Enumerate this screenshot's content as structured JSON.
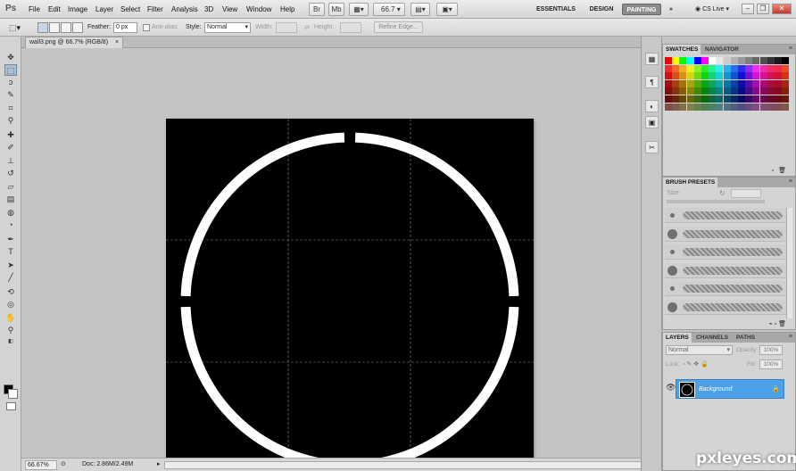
{
  "app": {
    "logo": "Ps"
  },
  "menu": [
    "File",
    "Edit",
    "Image",
    "Layer",
    "Select",
    "Filter",
    "Analysis",
    "3D",
    "View",
    "Window",
    "Help"
  ],
  "appbar": {
    "zoom": "66.7"
  },
  "workspaces": {
    "essentials": "ESSENTIALS",
    "design": "DESIGN",
    "painting": "PAINTING",
    "more": "»"
  },
  "cs_live": "CS Live",
  "options": {
    "feather_label": "Feather:",
    "feather_value": "0 px",
    "antialias_label": "Anti-alias",
    "style_label": "Style:",
    "style_value": "Normal",
    "width_label": "Width:",
    "height_label": "Height:",
    "refine_edge": "Refine Edge..."
  },
  "document": {
    "title": "wall3.png @ 66.7% (RGB/8)",
    "close": "×"
  },
  "status": {
    "zoom": "66.67%",
    "doc": "Doc: 2.86M/2.49M"
  },
  "panels": {
    "swatches_tab": "SWATCHES",
    "navigator_tab": "NAVIGATOR",
    "brush_presets_tab": "BRUSH PRESETS",
    "size_label": "Size:",
    "layers_tab": "LAYERS",
    "channels_tab": "CHANNELS",
    "paths_tab": "PATHS",
    "blend_mode": "Normal",
    "opacity_label": "Opacity:",
    "opacity_value": "100%",
    "lock_label": "Lock:",
    "fill_label": "Fill:",
    "fill_value": "100%",
    "layer_name": "Background"
  },
  "brush_presets": [
    {
      "size": "small"
    },
    {
      "size": "large"
    },
    {
      "size": "small"
    },
    {
      "size": "large"
    },
    {
      "size": "small"
    },
    {
      "size": "large"
    }
  ],
  "canvas": {
    "background": "#000000",
    "ring_color": "#ffffff",
    "guide_color": "#8a8a8a"
  },
  "watermark": "pxleyes.com"
}
